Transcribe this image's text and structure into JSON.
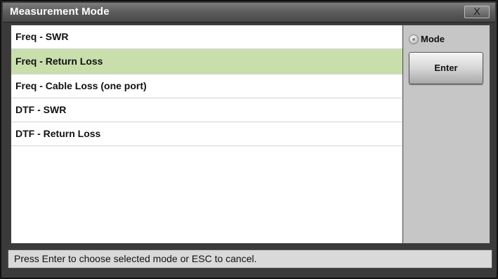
{
  "window": {
    "title": "Measurement Mode",
    "close_label": "X"
  },
  "list": {
    "items": [
      {
        "label": "Freq - SWR",
        "selected": false
      },
      {
        "label": "Freq - Return Loss",
        "selected": true
      },
      {
        "label": "Freq - Cable Loss (one port)",
        "selected": false
      },
      {
        "label": "DTF - SWR",
        "selected": false
      },
      {
        "label": "DTF - Return Loss",
        "selected": false
      }
    ]
  },
  "side": {
    "mode_label": "Mode",
    "enter_label": "Enter"
  },
  "status": {
    "message": "Press Enter to choose selected mode or ESC to cancel."
  },
  "colors": {
    "selected_row": "#c8dfac",
    "title_bar": "#5e5e5e",
    "side_panel": "#c6c6c6"
  }
}
